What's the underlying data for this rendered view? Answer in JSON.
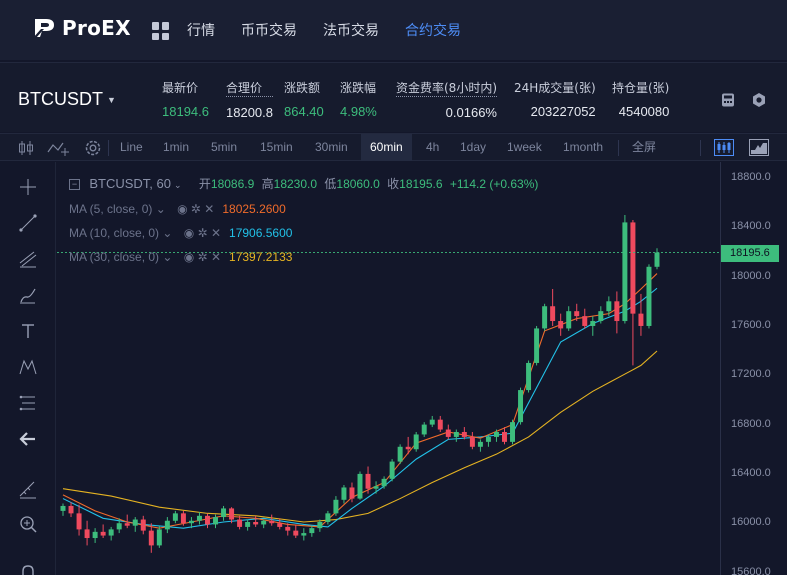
{
  "brand": {
    "name": "ProEX"
  },
  "nav": {
    "items": [
      {
        "label": "行情",
        "active": false
      },
      {
        "label": "币币交易",
        "active": false
      },
      {
        "label": "法币交易",
        "active": false
      },
      {
        "label": "合约交易",
        "active": true
      }
    ]
  },
  "ticker": {
    "pair": "BTCUSDT",
    "stats": [
      {
        "label": "最新价",
        "value": "18194.6",
        "color": "green"
      },
      {
        "label": "合理价",
        "value": "18200.8",
        "color": "white"
      },
      {
        "label": "涨跌额",
        "value": "864.40",
        "color": "green"
      },
      {
        "label": "涨跌幅",
        "value": "4.98%",
        "color": "green"
      },
      {
        "label": "资金费率(8小时内)",
        "value": "0.0166%",
        "color": "white"
      },
      {
        "label": "24H成交量(张)",
        "value": "203227052",
        "color": "white"
      },
      {
        "label": "持仓量(张)",
        "value": "4540080",
        "color": "white"
      }
    ]
  },
  "toolbar": {
    "intervals": [
      "Line",
      "1min",
      "5min",
      "15min",
      "30min",
      "60min",
      "4h",
      "1day",
      "1week",
      "1month"
    ],
    "active_interval": "60min",
    "fullscreen": "全屏"
  },
  "legend": {
    "symbol": "BTCUSDT, 60",
    "ohlc": {
      "open_label": "开",
      "open": "18086.9",
      "high_label": "高",
      "high": "18230.0",
      "low_label": "低",
      "low": "18060.0",
      "close_label": "收",
      "close": "18195.6",
      "change": "+114.2 (+0.63%)"
    },
    "ma": [
      {
        "label": "MA (5, close, 0)",
        "value": "18025.2600",
        "color": "#f06b2b"
      },
      {
        "label": "MA (10, close, 0)",
        "value": "17906.5600",
        "color": "#22c1e8"
      },
      {
        "label": "MA (30, close, 0)",
        "value": "17397.2133",
        "color": "#e5b322"
      }
    ]
  },
  "chart_data": {
    "type": "candlestick",
    "y_ticks": [
      "18800.0",
      "18400.0",
      "18000.0",
      "17600.0",
      "17200.0",
      "16800.0",
      "16400.0",
      "16000.0",
      "15600.0"
    ],
    "ylim": [
      15580,
      18930
    ],
    "current_price": "18195.6",
    "up_color": "#3dbd7d",
    "down_color": "#ef4a5e",
    "candles": [
      [
        16100,
        16160,
        16060,
        16140
      ],
      [
        16140,
        16170,
        16050,
        16080
      ],
      [
        16080,
        16150,
        15900,
        15950
      ],
      [
        15950,
        16020,
        15820,
        15880
      ],
      [
        15880,
        15960,
        15840,
        15930
      ],
      [
        15930,
        15990,
        15880,
        15900
      ],
      [
        15900,
        15970,
        15860,
        15950
      ],
      [
        15950,
        16040,
        15920,
        16000
      ],
      [
        16000,
        16070,
        15960,
        15980
      ],
      [
        15980,
        16050,
        15930,
        16030
      ],
      [
        16030,
        16060,
        15910,
        15940
      ],
      [
        15940,
        16000,
        15760,
        15820
      ],
      [
        15820,
        15980,
        15800,
        15950
      ],
      [
        15950,
        16050,
        15920,
        16020
      ],
      [
        16020,
        16100,
        16000,
        16080
      ],
      [
        16080,
        16100,
        15980,
        16000
      ],
      [
        16000,
        16050,
        15960,
        16020
      ],
      [
        16020,
        16090,
        15990,
        16060
      ],
      [
        16060,
        16080,
        15960,
        15990
      ],
      [
        15990,
        16070,
        15960,
        16050
      ],
      [
        16050,
        16140,
        16020,
        16120
      ],
      [
        16120,
        16130,
        16000,
        16030
      ],
      [
        16030,
        16060,
        15950,
        15970
      ],
      [
        15970,
        16030,
        15940,
        16010
      ],
      [
        16010,
        16060,
        15970,
        15990
      ],
      [
        15990,
        16030,
        15960,
        16020
      ],
      [
        16020,
        16070,
        15980,
        16000
      ],
      [
        16000,
        16040,
        15950,
        15970
      ],
      [
        15970,
        16000,
        15900,
        15940
      ],
      [
        15940,
        15990,
        15880,
        15900
      ],
      [
        15900,
        15960,
        15860,
        15920
      ],
      [
        15920,
        15980,
        15890,
        15960
      ],
      [
        15960,
        16030,
        15930,
        16010
      ],
      [
        16010,
        16100,
        15990,
        16080
      ],
      [
        16080,
        16220,
        16060,
        16190
      ],
      [
        16190,
        16310,
        16160,
        16290
      ],
      [
        16290,
        16330,
        16170,
        16200
      ],
      [
        16200,
        16420,
        16190,
        16400
      ],
      [
        16400,
        16460,
        16240,
        16280
      ],
      [
        16280,
        16340,
        16240,
        16300
      ],
      [
        16300,
        16380,
        16280,
        16360
      ],
      [
        16360,
        16520,
        16340,
        16500
      ],
      [
        16500,
        16640,
        16480,
        16620
      ],
      [
        16620,
        16700,
        16560,
        16600
      ],
      [
        16600,
        16740,
        16580,
        16720
      ],
      [
        16720,
        16820,
        16700,
        16800
      ],
      [
        16800,
        16870,
        16780,
        16840
      ],
      [
        16840,
        16870,
        16740,
        16760
      ],
      [
        16760,
        16800,
        16680,
        16700
      ],
      [
        16700,
        16760,
        16660,
        16740
      ],
      [
        16740,
        16780,
        16680,
        16700
      ],
      [
        16700,
        16740,
        16600,
        16620
      ],
      [
        16620,
        16680,
        16580,
        16660
      ],
      [
        16660,
        16720,
        16620,
        16700
      ],
      [
        16700,
        16760,
        16660,
        16740
      ],
      [
        16740,
        16780,
        16640,
        16660
      ],
      [
        16660,
        16840,
        16640,
        16820
      ],
      [
        16820,
        17100,
        16800,
        17080
      ],
      [
        17080,
        17320,
        17060,
        17300
      ],
      [
        17300,
        17600,
        17280,
        17580
      ],
      [
        17580,
        17780,
        17560,
        17760
      ],
      [
        17760,
        17900,
        17600,
        17640
      ],
      [
        17640,
        17700,
        17520,
        17580
      ],
      [
        17580,
        17760,
        17560,
        17720
      ],
      [
        17720,
        17780,
        17640,
        17680
      ],
      [
        17680,
        17740,
        17580,
        17600
      ],
      [
        17600,
        17680,
        17520,
        17640
      ],
      [
        17640,
        17760,
        17620,
        17720
      ],
      [
        17720,
        17840,
        17680,
        17800
      ],
      [
        17800,
        17880,
        17540,
        17640
      ],
      [
        17640,
        18500,
        17620,
        18440
      ],
      [
        18440,
        18460,
        17280,
        17700
      ],
      [
        17700,
        17860,
        17520,
        17600
      ],
      [
        17600,
        18100,
        17580,
        18080
      ],
      [
        18080,
        18230,
        18060,
        18195.6
      ]
    ],
    "ma5": [
      [
        0,
        16230
      ],
      [
        4,
        16100
      ],
      [
        8,
        16010
      ],
      [
        12,
        15960
      ],
      [
        16,
        16010
      ],
      [
        20,
        16060
      ],
      [
        24,
        16040
      ],
      [
        28,
        15990
      ],
      [
        32,
        15970
      ],
      [
        36,
        16210
      ],
      [
        40,
        16330
      ],
      [
        44,
        16650
      ],
      [
        48,
        16740
      ],
      [
        52,
        16690
      ],
      [
        56,
        16800
      ],
      [
        60,
        17560
      ],
      [
        64,
        17660
      ],
      [
        68,
        17700
      ],
      [
        70,
        17780
      ],
      [
        72,
        17900
      ],
      [
        74,
        18025
      ]
    ],
    "ma10": [
      [
        0,
        16200
      ],
      [
        5,
        16040
      ],
      [
        10,
        15990
      ],
      [
        15,
        15960
      ],
      [
        20,
        16010
      ],
      [
        25,
        16040
      ],
      [
        30,
        15990
      ],
      [
        33,
        15970
      ],
      [
        36,
        16120
      ],
      [
        40,
        16300
      ],
      [
        44,
        16520
      ],
      [
        48,
        16680
      ],
      [
        52,
        16700
      ],
      [
        56,
        16730
      ],
      [
        59,
        17100
      ],
      [
        62,
        17470
      ],
      [
        66,
        17620
      ],
      [
        70,
        17720
      ],
      [
        72,
        17800
      ],
      [
        74,
        17906
      ]
    ],
    "ma30": [
      [
        0,
        16280
      ],
      [
        6,
        16220
      ],
      [
        12,
        16130
      ],
      [
        18,
        16080
      ],
      [
        24,
        16060
      ],
      [
        30,
        16010
      ],
      [
        34,
        16030
      ],
      [
        38,
        16080
      ],
      [
        42,
        16200
      ],
      [
        46,
        16330
      ],
      [
        50,
        16450
      ],
      [
        54,
        16560
      ],
      [
        58,
        16700
      ],
      [
        62,
        16900
      ],
      [
        66,
        17070
      ],
      [
        70,
        17210
      ],
      [
        72,
        17280
      ],
      [
        74,
        17397
      ]
    ]
  }
}
